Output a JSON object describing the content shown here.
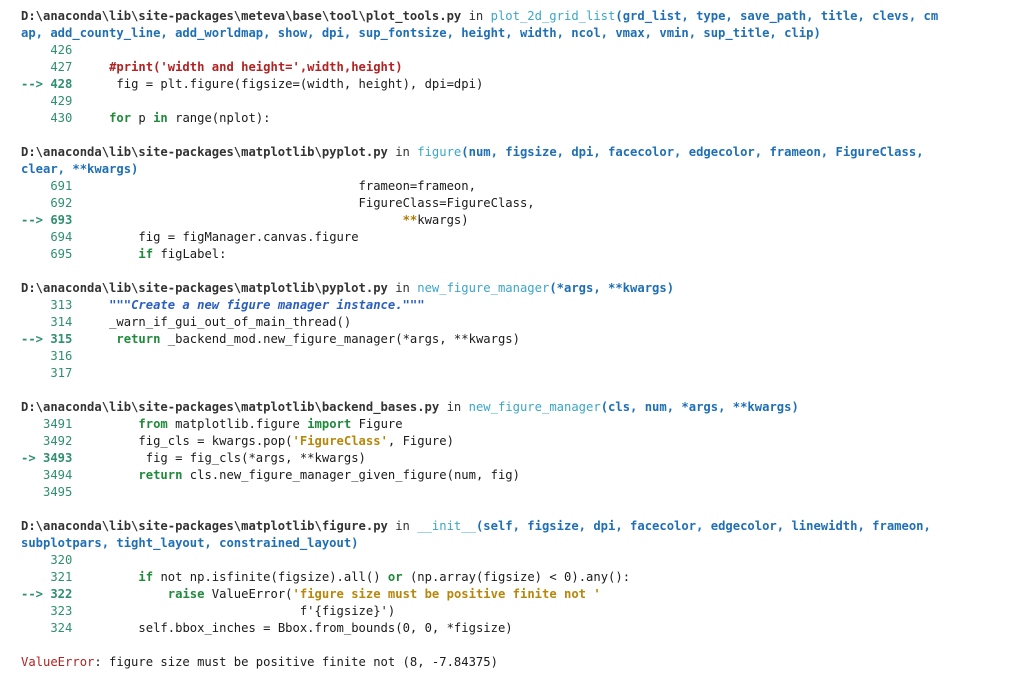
{
  "frames": [
    {
      "path": "D:\\anaconda\\lib\\site-packages\\meteva\\base\\tool\\plot_tools.py",
      "in_word": " in ",
      "func": "plot_2d_grid_list",
      "sig_line1": "(grd_list, type, save_path, title, clevs, cm",
      "sig_line2": "ap, add_county_line, add_worldmap, show, dpi, sup_fontsize, height, width, ncol, vmax, vmin, sup_title, clip)",
      "lines": [
        {
          "marker": "    426",
          "indent": "",
          "code": ""
        },
        {
          "marker": "    427",
          "indent": "     ",
          "comment": "#print('width and height=',width,height)"
        },
        {
          "marker": "--> 428",
          "indent": "      ",
          "code": "fig = plt.figure(figsize=(width, height), dpi=dpi)"
        },
        {
          "marker": "    429",
          "indent": "",
          "code": ""
        },
        {
          "marker": "    430",
          "indent": "     ",
          "kw": "for",
          "code": " p ",
          "kw2": "in",
          "code2": " range(nplot):"
        }
      ]
    },
    {
      "path": "D:\\anaconda\\lib\\site-packages\\matplotlib\\pyplot.py",
      "in_word": " in ",
      "func": "figure",
      "sig_line1": "(num, figsize, dpi, facecolor, edgecolor, frameon, FigureClass,",
      "sig_line2": "clear, **kwargs)",
      "lines": [
        {
          "marker": "    691",
          "indent": "                                       ",
          "code": "frameon=frameon,"
        },
        {
          "marker": "    692",
          "indent": "                                       ",
          "code": "FigureClass=FigureClass,"
        },
        {
          "marker": "--> 693",
          "indent": "                                             ",
          "op": "**",
          "code": "kwargs)"
        },
        {
          "marker": "    694",
          "indent": "         ",
          "code": "fig = figManager.canvas.figure"
        },
        {
          "marker": "    695",
          "indent": "         ",
          "kw": "if",
          "code": " figLabel:"
        }
      ]
    },
    {
      "path": "D:\\anaconda\\lib\\site-packages\\matplotlib\\pyplot.py",
      "in_word": " in ",
      "func": "new_figure_manager",
      "sig_line1": "(*args, **kwargs)",
      "sig_line2": "",
      "lines": [
        {
          "marker": "    313",
          "indent": "     ",
          "doc": "\"\"\"Create a new figure manager instance.\"\"\""
        },
        {
          "marker": "    314",
          "indent": "     ",
          "code": "_warn_if_gui_out_of_main_thread()"
        },
        {
          "marker": "--> 315",
          "indent": "      ",
          "kw": "return",
          "code": " _backend_mod.new_figure_manager(*args, **kwargs)"
        },
        {
          "marker": "    316",
          "indent": "",
          "code": ""
        },
        {
          "marker": "    317",
          "indent": "",
          "code": ""
        }
      ]
    },
    {
      "path": "D:\\anaconda\\lib\\site-packages\\matplotlib\\backend_bases.py",
      "in_word": " in ",
      "func": "new_figure_manager",
      "sig_line1": "(cls, num, *args, **kwargs)",
      "sig_line2": "",
      "lines": [
        {
          "marker": "   3491",
          "indent": "         ",
          "kw": "from",
          "code": " matplotlib.figure ",
          "kw2": "import",
          "code2": " Figure"
        },
        {
          "marker": "   3492",
          "indent": "         ",
          "code": "fig_cls = kwargs.pop(",
          "str": "'FigureClass'",
          "code2": ", Figure)"
        },
        {
          "marker": "-> 3493",
          "indent": "          ",
          "code": "fig = fig_cls(*args, **kwargs)"
        },
        {
          "marker": "   3494",
          "indent": "         ",
          "kw": "return",
          "code": " cls.new_figure_manager_given_figure(num, fig)"
        },
        {
          "marker": "   3495",
          "indent": "",
          "code": ""
        }
      ]
    },
    {
      "path": "D:\\anaconda\\lib\\site-packages\\matplotlib\\figure.py",
      "in_word": " in ",
      "func": "__init__",
      "sig_line1": "(self, figsize, dpi, facecolor, edgecolor, linewidth, frameon,",
      "sig_line2": "subplotpars, tight_layout, constrained_layout)",
      "lines": [
        {
          "marker": "    320",
          "indent": "",
          "code": ""
        },
        {
          "marker": "    321",
          "indent": "         ",
          "kw": "if",
          "code": " not np.isfinite(figsize).all() ",
          "kw2": "or",
          "code2": " (np.array(figsize) < 0).any():"
        },
        {
          "marker": "--> 322",
          "indent": "             ",
          "kw": "raise",
          "code": " ValueError(",
          "str": "'figure size must be positive finite not '"
        },
        {
          "marker": "    323",
          "indent": "                               ",
          "code": "f'{figsize}')"
        },
        {
          "marker": "    324",
          "indent": "         ",
          "code": "self.bbox_inches = Bbox.from_bounds(0, 0, *figsize)"
        }
      ]
    }
  ],
  "error": {
    "type": "ValueError",
    "message": ": figure size must be positive finite not (8, -7.84375)"
  }
}
